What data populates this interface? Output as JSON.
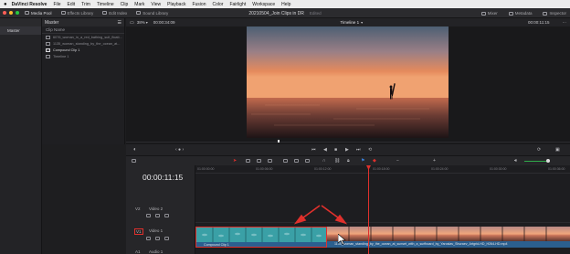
{
  "menubar": {
    "app_name": "DaVinci Resolve",
    "items": [
      "File",
      "Edit",
      "Trim",
      "Timeline",
      "Clip",
      "Mark",
      "View",
      "Playback",
      "Fusion",
      "Color",
      "Fairlight",
      "Workspace",
      "Help"
    ]
  },
  "toolbar": {
    "left_items": [
      "Media Pool",
      "Effects Library",
      "Edit Index",
      "Sound Library"
    ],
    "project_title": "20210504_Join Clips in DR",
    "project_status": "Edited",
    "right_items": [
      "Mixer",
      "Metadata",
      "Inspector"
    ]
  },
  "left_panel": {
    "header": "",
    "selected_bin": "Master"
  },
  "media_pool": {
    "bin_label": "Master",
    "column_header": "Clip Name",
    "clips": [
      {
        "name": "6076_woman_in_a_red_bathing_suit_floati...",
        "bright": false
      },
      {
        "name": "1135_woman_standing_by_the_ocean_at...",
        "bright": false
      },
      {
        "name": "Compound Clip 1",
        "bright": true
      },
      {
        "name": "Timeline 1",
        "bright": false
      }
    ]
  },
  "viewer": {
    "zoom": "38%",
    "source_timecode": "00:00:34:09",
    "timeline_name": "Timeline 1",
    "record_timecode": "00:00:11:15"
  },
  "timeline": {
    "timecode": "00:00:11:15",
    "ruler_labels": [
      "01:00:00:00",
      "01:00:06:00",
      "01:00:12:00",
      "01:00:18:00",
      "01:00:24:00",
      "01:00:30:00",
      "01:00:36:00"
    ],
    "tracks": [
      {
        "id": "V2",
        "name": "Video 2"
      },
      {
        "id": "V1",
        "name": "Video 1"
      },
      {
        "id": "A1",
        "name": "Audio 1"
      }
    ],
    "clip1_label": "Compound Clip 1",
    "clip2_label": "1135_woman_standing_by_the_ocean_at_sunset_with_a_surfboard_by_Yaroslav_Shuraev_Artgrid-HD_H264-HD.mp4",
    "playhead_fraction": 0.46
  },
  "colors": {
    "accent_red": "#e0302c",
    "clip_teal": "#2e8f95",
    "clip_blue": "#3a6fb0",
    "sky_orange": "#e8895a"
  }
}
